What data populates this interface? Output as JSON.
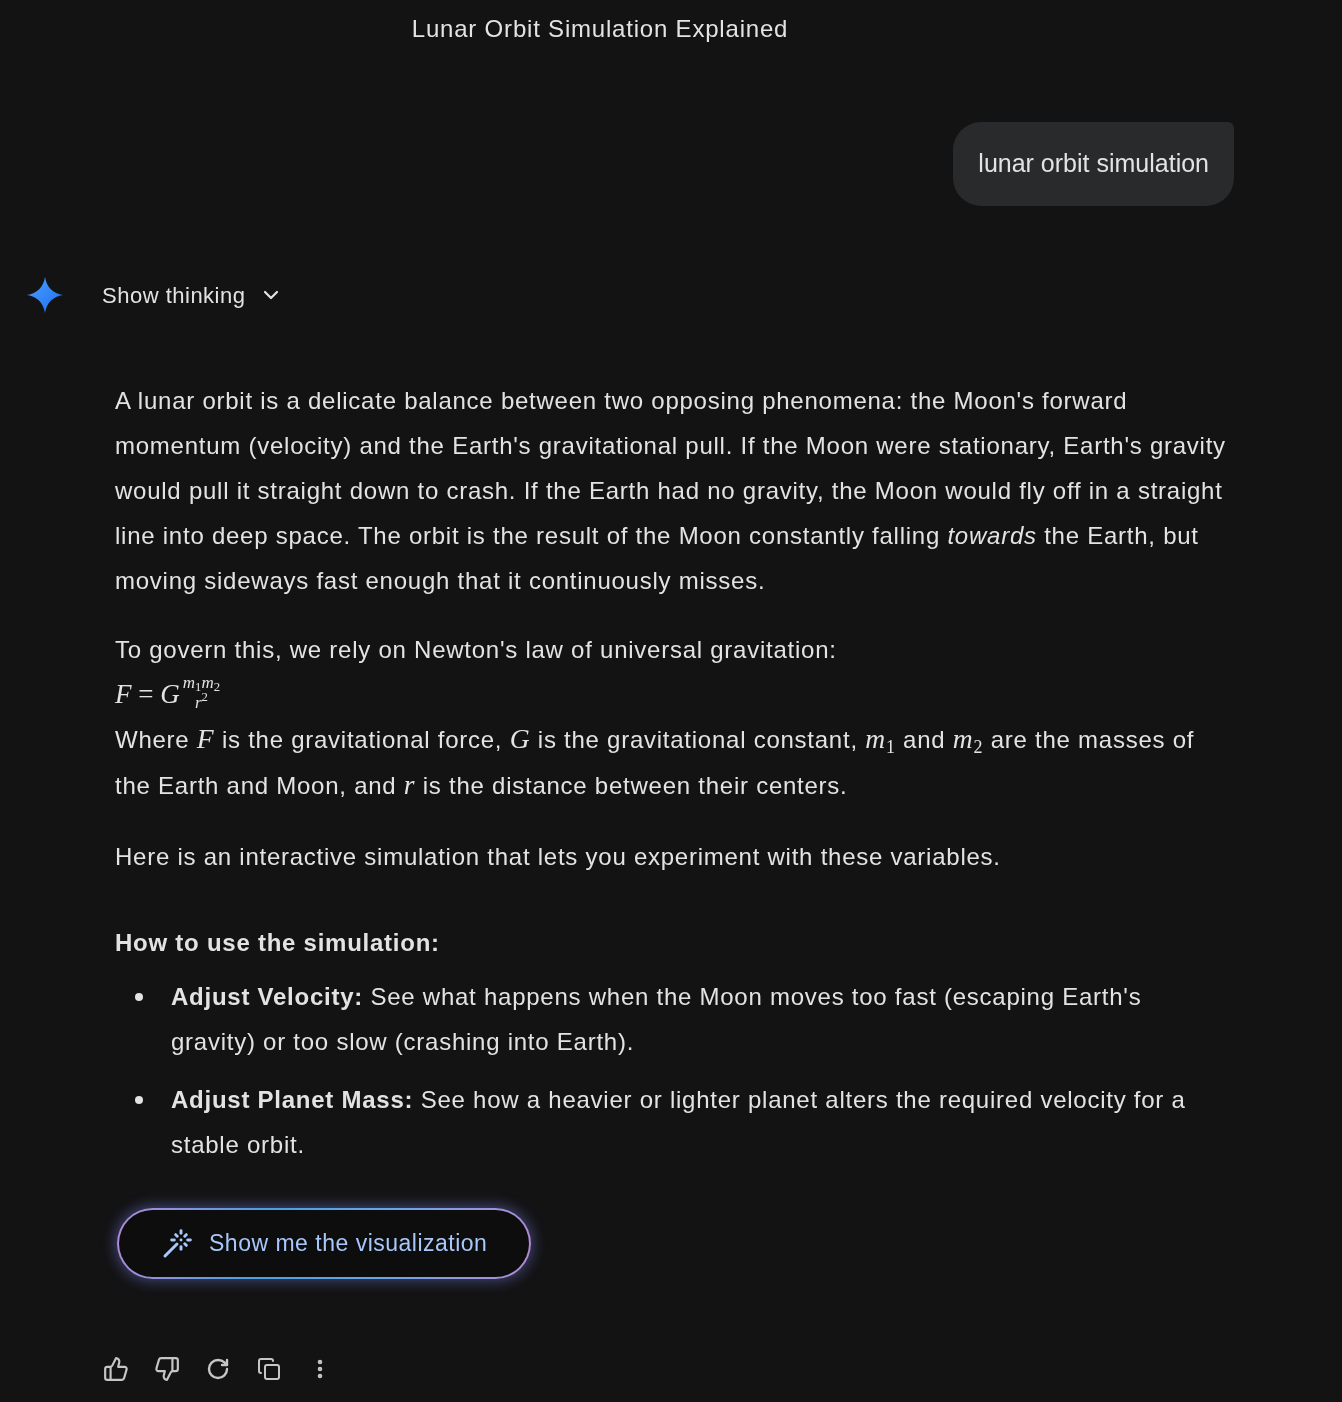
{
  "header": {
    "title": "Lunar Orbit Simulation Explained"
  },
  "user_message": {
    "text": "lunar orbit simulation"
  },
  "response": {
    "thinking_toggle": {
      "label": "Show thinking",
      "expanded": false
    },
    "blocks": [
      {
        "kind": "paragraph",
        "text": "A lunar orbit is a delicate balance between two opposing phenomena: the Moon's forward momentum (velocity) and the Earth's gravitational pull. If the Moon were stationary, Earth's gravity would pull it straight down to crash. If the Earth had no gravity, the Moon would fly off in a straight line into deep space. The orbit is the result of the Moon constantly falling *towards* the Earth, but moving sideways fast enough that it continuously misses."
      },
      {
        "kind": "equation",
        "intro": "To govern this, we rely on Newton's law of universal gravitation:",
        "formula": {
          "left": "*F* = *G*",
          "numerator": "*m*$_{1}$*m*$_{2}$",
          "denominator": "*r*$^{2}$"
        },
        "explanation": "Where *F* is the gravitational force, *G* is the gravitational constant, *m*$_{1}$ and *m*$_{2}$ are the masses of the Earth and Moon, and *r* is the distance between their centers."
      },
      {
        "kind": "paragraph",
        "text": "Here is an interactive simulation that lets you experiment with these variables."
      },
      {
        "kind": "heading",
        "text": "How to use the simulation:"
      },
      {
        "kind": "list",
        "items": [
          "**Adjust Velocity:** See what happens when the Moon moves too fast (escaping Earth's gravity) or too slow (crashing into Earth).",
          "**Adjust Planet Mass:** See how a heavier or lighter planet alters the required velocity for a stable orbit."
        ]
      }
    ],
    "action_button": {
      "label": "Show me the visualization"
    }
  }
}
